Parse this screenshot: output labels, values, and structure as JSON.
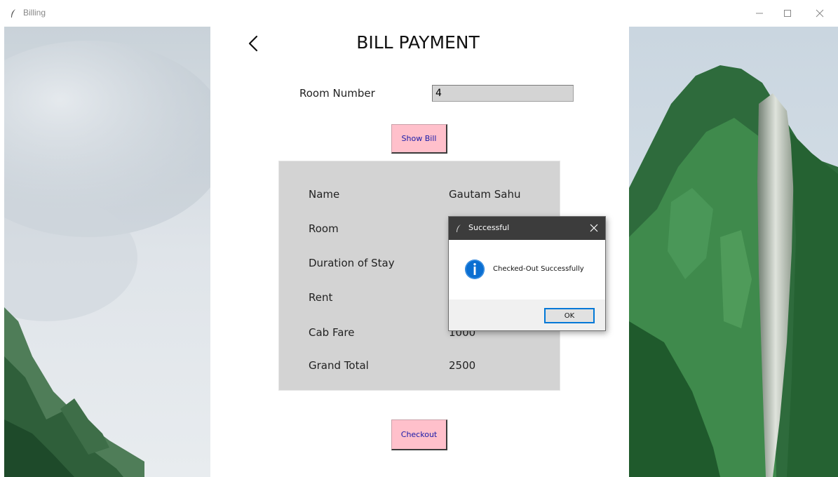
{
  "window": {
    "title": "Billing",
    "icon": "feather-icon",
    "controls": [
      "minimize-icon",
      "maximize-icon",
      "close-icon"
    ]
  },
  "page": {
    "title": "BILL PAYMENT",
    "back_icon": "chevron-left-icon"
  },
  "room_input": {
    "label": "Room Number",
    "value": "4"
  },
  "buttons": {
    "show_bill": "Show Bill",
    "checkout": "Checkout"
  },
  "bill": {
    "rows": [
      {
        "label": "Name",
        "value": "Gautam Sahu"
      },
      {
        "label": "Room",
        "value": ""
      },
      {
        "label": "Duration of Stay",
        "value": ""
      },
      {
        "label": "Rent",
        "value": ""
      },
      {
        "label": "Cab Fare",
        "value": "1000"
      },
      {
        "label": "Grand Total",
        "value": "2500"
      }
    ]
  },
  "dialog": {
    "title": "Successful",
    "message": "Checked-Out Successfully",
    "ok_label": "OK",
    "icon": "info-icon"
  },
  "colors": {
    "button_pink": "#ffc0cb",
    "button_text": "#1a1aa8",
    "panel_gray": "#d3d3d3",
    "dialog_titlebar": "#3c3c3c",
    "info_blue": "#0a6ed1"
  }
}
